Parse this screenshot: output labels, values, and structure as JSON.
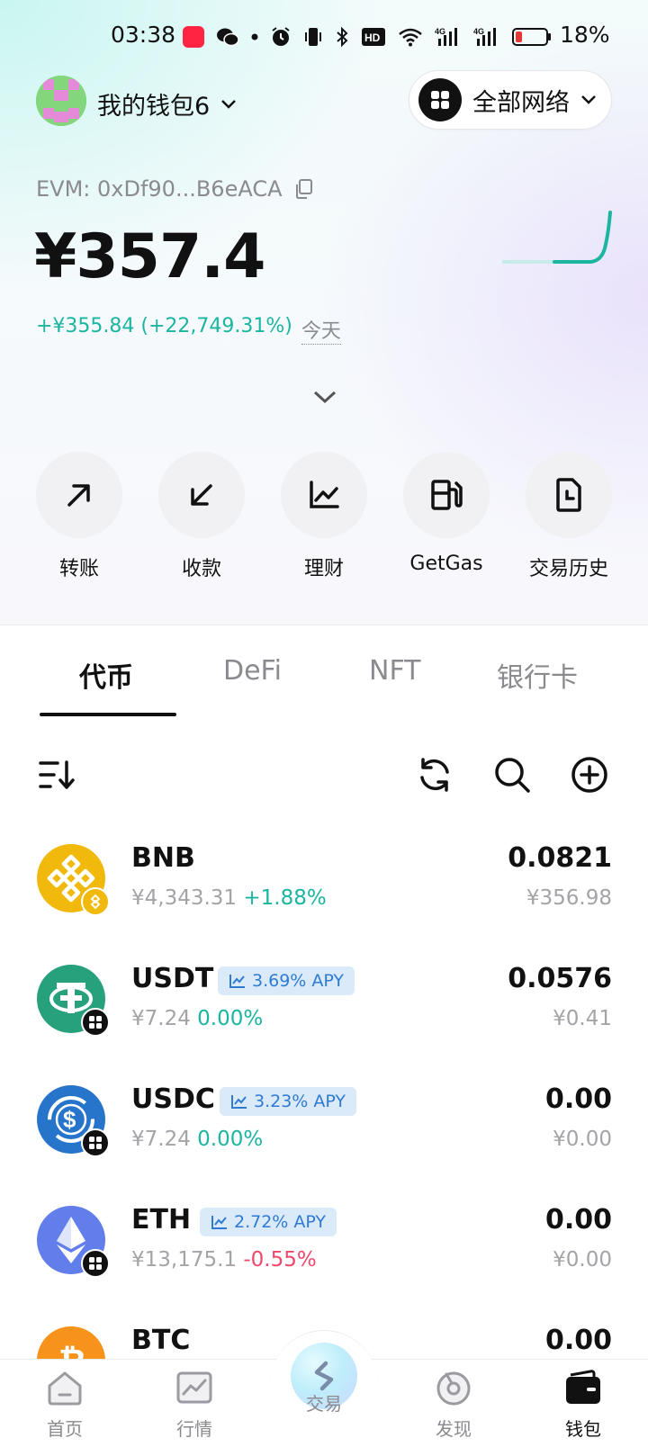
{
  "status_bar": {
    "time": "03:38",
    "battery": "18%",
    "icons": [
      "xiaohongshu-icon",
      "wechat-icon",
      "dot-icon",
      "alarm-icon",
      "vibrate-icon",
      "bluetooth-icon",
      "hd-icon",
      "wifi-icon",
      "signal-4g-icon",
      "signal-4g-icon",
      "battery-icon"
    ]
  },
  "wallet": {
    "name": "我的钱包6",
    "network_label": "全部网络",
    "address": "EVM: 0xDf90...B6eACA",
    "balance": "¥357.4",
    "change": "+¥355.84 (+22,749.31%)",
    "change_period": "今天"
  },
  "actions": [
    {
      "label": "转账",
      "icon": "arrow-up-right-icon"
    },
    {
      "label": "收款",
      "icon": "arrow-down-left-icon"
    },
    {
      "label": "理财",
      "icon": "chart-line-icon"
    },
    {
      "label": "GetGas",
      "icon": "gas-pump-icon"
    },
    {
      "label": "交易历史",
      "icon": "history-doc-icon"
    }
  ],
  "tabs": [
    "代币",
    "DeFi",
    "NFT",
    "银行卡"
  ],
  "active_tab": "代币",
  "tokens": [
    {
      "symbol": "BNB",
      "price": "¥4,343.31",
      "change": "+1.88%",
      "amount": "0.0821",
      "value": "¥356.98",
      "apy": null,
      "icon_color": "#f0b90b"
    },
    {
      "symbol": "USDT",
      "price": "¥7.24",
      "change": "0.00%",
      "amount": "0.0576",
      "value": "¥0.41",
      "apy": "3.69% APY",
      "icon_color": "#26a17b"
    },
    {
      "symbol": "USDC",
      "price": "¥7.24",
      "change": "0.00%",
      "amount": "0.00",
      "value": "¥0.00",
      "apy": "3.23% APY",
      "icon_color": "#2775ca"
    },
    {
      "symbol": "ETH",
      "price": "¥13,175.1",
      "change": "-0.55%",
      "amount": "0.00",
      "value": "¥0.00",
      "apy": "2.72% APY",
      "icon_color": "#627eea"
    },
    {
      "symbol": "BTC",
      "amount": "0.00",
      "icon_color": "#f7931a"
    }
  ],
  "nav": [
    {
      "label": "首页",
      "icon": "home-icon"
    },
    {
      "label": "行情",
      "icon": "market-chart-icon"
    },
    {
      "label": "交易",
      "icon": "swap-icon"
    },
    {
      "label": "发现",
      "icon": "discover-icon"
    },
    {
      "label": "钱包",
      "icon": "wallet-icon"
    }
  ],
  "active_nav": "钱包",
  "colors": {
    "accent_green": "#1bb5a0",
    "negative_red": "#f0486b",
    "apy_blue": "#2f7bd3"
  }
}
